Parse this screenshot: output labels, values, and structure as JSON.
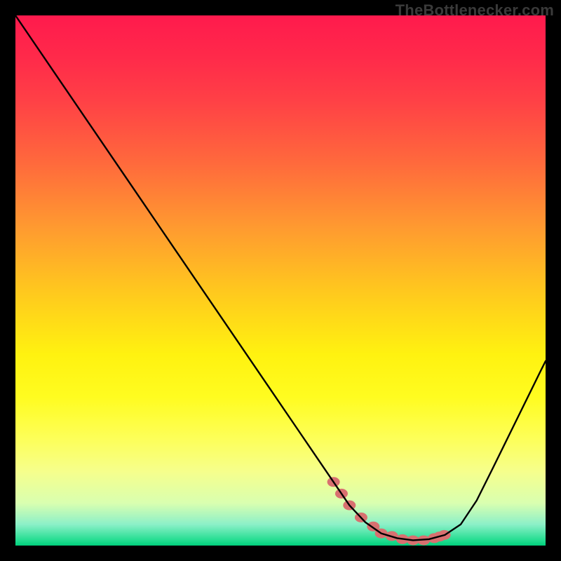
{
  "watermark": {
    "text": "TheBottlenecker.com"
  },
  "chart_data": {
    "type": "line",
    "title": "",
    "xlabel": "",
    "ylabel": "",
    "xlim": [
      0,
      100
    ],
    "ylim": [
      0,
      100
    ],
    "x": [
      0,
      3,
      6,
      9,
      12,
      15,
      18,
      21,
      24,
      27,
      30,
      33,
      36,
      39,
      42,
      45,
      48,
      51,
      54,
      57,
      60,
      63,
      66,
      69,
      72,
      75,
      78,
      81,
      84,
      87,
      90,
      93,
      96,
      99,
      100
    ],
    "y": [
      100,
      95.6,
      91.2,
      86.8,
      82.4,
      78.0,
      73.6,
      69.2,
      64.8,
      60.4,
      56.0,
      51.6,
      47.2,
      42.8,
      38.4,
      34.0,
      29.6,
      25.2,
      20.8,
      16.4,
      12.0,
      7.6,
      4.4,
      2.3,
      1.4,
      1.0,
      1.2,
      2.0,
      4.0,
      8.5,
      14.5,
      20.6,
      26.7,
      32.8,
      34.8
    ],
    "marker_bounds": {
      "x0": 60,
      "x1": 80,
      "y0": 1.0,
      "y1": 7.6
    },
    "markers": [
      {
        "x": 60.0,
        "y": 12.0
      },
      {
        "x": 61.5,
        "y": 9.8
      },
      {
        "x": 63.0,
        "y": 7.6
      },
      {
        "x": 65.2,
        "y": 5.3
      },
      {
        "x": 67.5,
        "y": 3.6
      },
      {
        "x": 69.0,
        "y": 2.3
      },
      {
        "x": 71.0,
        "y": 1.8
      },
      {
        "x": 73.0,
        "y": 1.2
      },
      {
        "x": 75.0,
        "y": 1.0
      },
      {
        "x": 77.0,
        "y": 1.0
      },
      {
        "x": 79.0,
        "y": 1.4
      },
      {
        "x": 80.0,
        "y": 1.7
      },
      {
        "x": 80.9,
        "y": 2.0
      }
    ],
    "colors": {
      "curve": "#000000",
      "marker": "#d87070",
      "gradient_top": "#ff1a4d",
      "gradient_bottom": "#00cf7c"
    }
  }
}
